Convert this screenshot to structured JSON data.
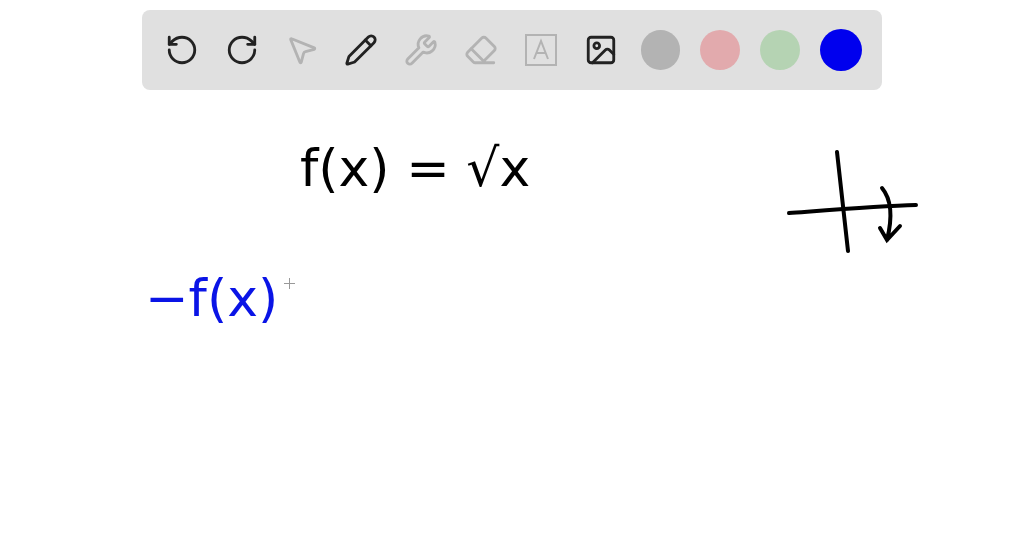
{
  "toolbar": {
    "tools": [
      {
        "kind": "undo",
        "disabled": false
      },
      {
        "kind": "redo",
        "disabled": false
      },
      {
        "kind": "pointer",
        "disabled": true
      },
      {
        "kind": "pen",
        "disabled": false
      },
      {
        "kind": "tools",
        "disabled": true
      },
      {
        "kind": "eraser",
        "disabled": true
      },
      {
        "kind": "text",
        "disabled": true
      },
      {
        "kind": "image",
        "disabled": false
      }
    ],
    "colors": [
      {
        "color": "#b3b3b3",
        "selected": false
      },
      {
        "color": "#e2aaad",
        "selected": false
      },
      {
        "color": "#b5d3b3",
        "selected": false
      },
      {
        "color": "#0000ee",
        "selected": true
      }
    ]
  },
  "canvas": {
    "notes": [
      {
        "text": "f(x) = √x",
        "color": "#000000"
      },
      {
        "text": "−f(x)",
        "color": "#0a14e6"
      }
    ]
  }
}
